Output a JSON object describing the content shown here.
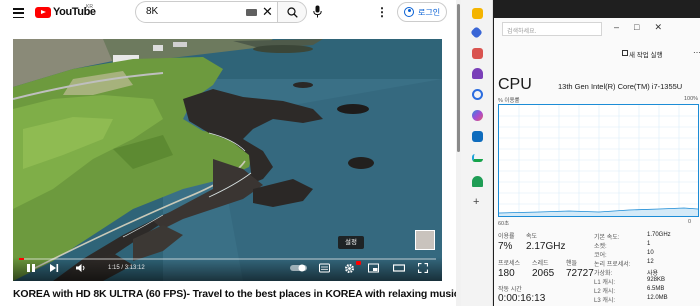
{
  "youtube": {
    "logo_text": "YouTube",
    "logo_region": "KR",
    "search": {
      "value": "8K"
    },
    "login_label": "로그인",
    "tooltip": "설정",
    "player": {
      "current_time": "1:15",
      "duration": "3:13:12",
      "progress_fraction": 0.006
    },
    "video_title": "KOREA with HD 8K ULTRA (60 FPS)- Travel to the best places in KOREA with relaxing music 8K TV"
  },
  "task_manager": {
    "search_placeholder": "검색하세요.",
    "new_task_label": "새 작업 실행",
    "cpu_title": "CPU",
    "cpu_model": "13th Gen Intel(R) Core(TM) i7-1355U",
    "usage_label": "% 이용률",
    "usage_max": "100%",
    "graph_left": "60초",
    "graph_right": "0",
    "stats": {
      "util_label": "이용률",
      "util_value": "7%",
      "speed_label": "속도",
      "speed_value": "2.17GHz",
      "proc_label": "프로세스",
      "proc_value": "180",
      "threads_label": "스레드",
      "threads_value": "2065",
      "handles_label": "핸들",
      "handles_value": "72727",
      "uptime_label": "작동 시간",
      "uptime_value": "0:00:16:13"
    },
    "specs": [
      {
        "key": "기본 속도:",
        "value": "1.70GHz"
      },
      {
        "key": "소켓:",
        "value": "1"
      },
      {
        "key": "코어:",
        "value": "10"
      },
      {
        "key": "논리 프로세서:",
        "value": "12"
      },
      {
        "key": "가상화:",
        "value": "사용"
      },
      {
        "key": "L1 캐시:",
        "value": "928KB"
      },
      {
        "key": "L2 캐시:",
        "value": "6.5MB"
      },
      {
        "key": "L3 캐시:",
        "value": "12.0MB"
      }
    ]
  },
  "icons": {
    "sidebar": [
      "notes-icon",
      "tag-icon",
      "briefcase-icon",
      "person-icon",
      "search-icon",
      "copilot-icon",
      "outlook-icon",
      "shopping-icon",
      "tree-icon",
      "add-icon"
    ],
    "colors": {
      "accent": "#1c8cd6",
      "youtube_red": "#ff0000",
      "link_blue": "#065fd4"
    }
  }
}
